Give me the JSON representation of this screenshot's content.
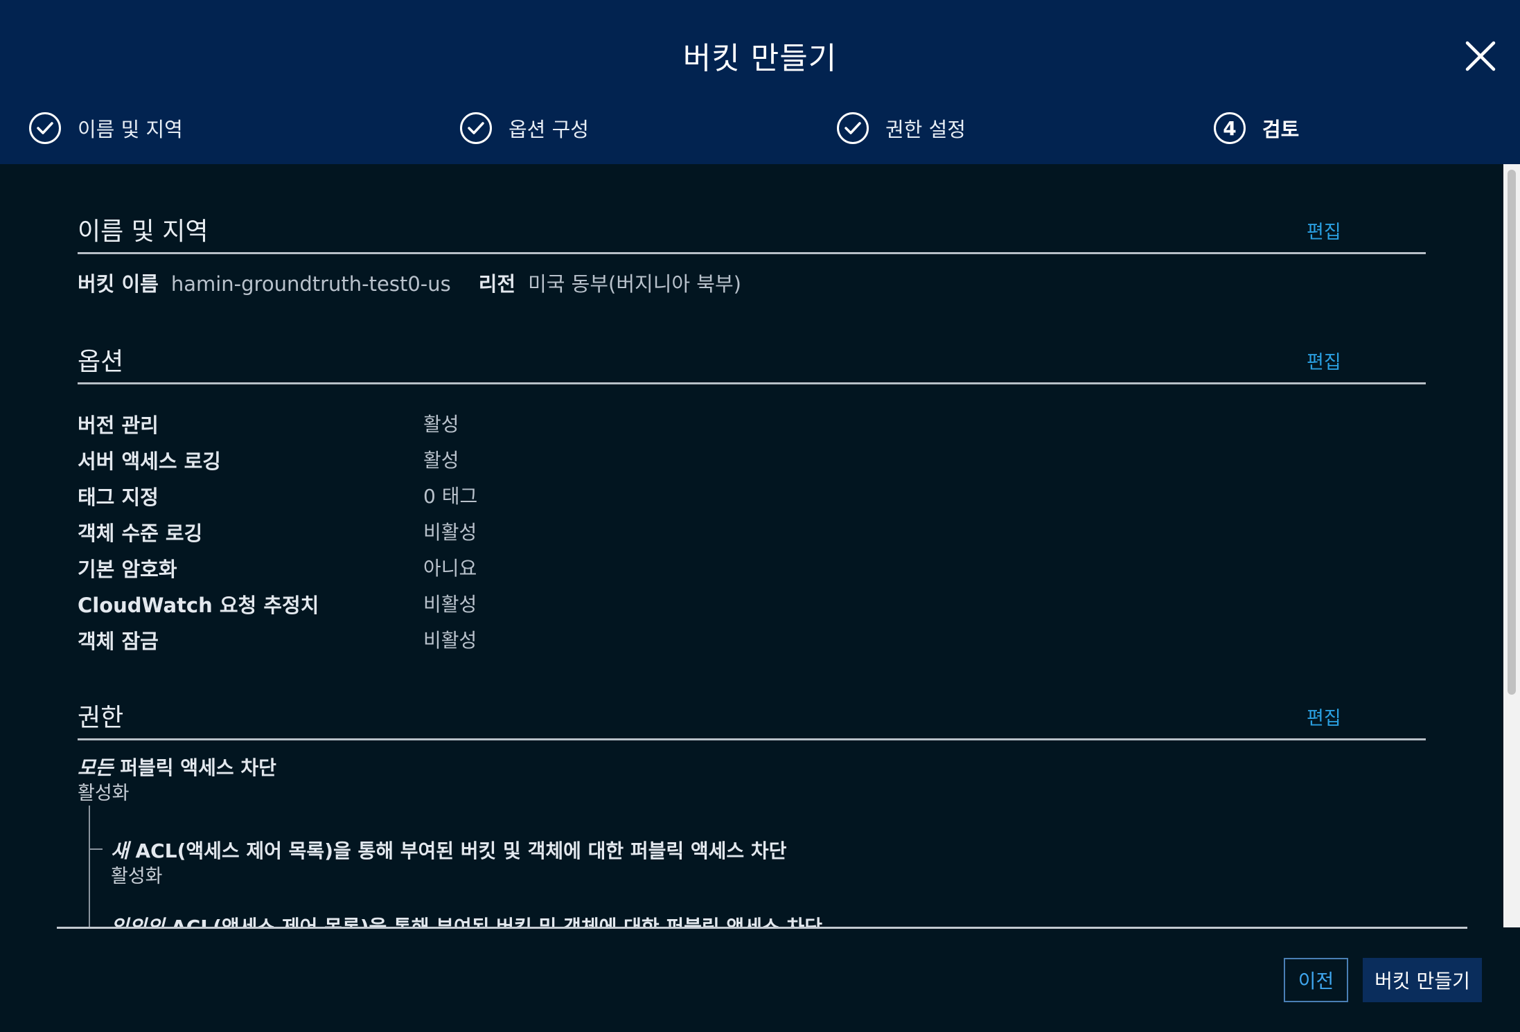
{
  "dialog": {
    "title": "버킷 만들기",
    "close_icon": "close-icon"
  },
  "steps": [
    {
      "label": "이름 및 지역",
      "status": "done",
      "icon": "check-icon"
    },
    {
      "label": "옵션 구성",
      "status": "done",
      "icon": "check-icon"
    },
    {
      "label": "권한 설정",
      "status": "done",
      "icon": "check-icon"
    },
    {
      "label": "검토",
      "status": "active",
      "number": "4"
    }
  ],
  "sections": {
    "name_region": {
      "title": "이름 및 지역",
      "edit": "편집",
      "bucket_name_label": "버킷 이름",
      "bucket_name_value": "hamin-groundtruth-test0-us",
      "region_label": "리전",
      "region_value": "미국 동부(버지니아 북부)"
    },
    "options": {
      "title": "옵션",
      "edit": "편집",
      "rows": [
        {
          "label": "버전 관리",
          "value": "활성"
        },
        {
          "label": "서버 액세스 로깅",
          "value": "활성"
        },
        {
          "label": "태그 지정",
          "value": "0 태그"
        },
        {
          "label": "객체 수준 로깅",
          "value": "비활성"
        },
        {
          "label": "기본 암호화",
          "value": "아니요"
        },
        {
          "label": "CloudWatch 요청 추정치",
          "value": "비활성"
        },
        {
          "label": "객체 잠금",
          "value": "비활성"
        }
      ]
    },
    "permissions": {
      "title": "권한",
      "edit": "편집",
      "block_all_em": "모든",
      "block_all_rest": " 퍼블릭 액세스 차단",
      "block_all_value": "활성화",
      "sub1_em": "새",
      "sub1_rest": " ACL(액세스 제어 목록)을 통해 부여된 버킷 및 객체에 대한 퍼블릭 액세스 차단",
      "sub1_value": "활성화",
      "sub2_em": "임의의",
      "sub2_rest": " ACL(액세스 제어 목록)을 통해 부여된 버킷 및 객체에 대한 퍼블릭 액세스 차단"
    }
  },
  "footer": {
    "prev_label": "이전",
    "create_label": "버킷 만들기"
  },
  "colors": {
    "header_bg": "#022350",
    "body_bg": "#021520",
    "link": "#2a9fe0"
  }
}
